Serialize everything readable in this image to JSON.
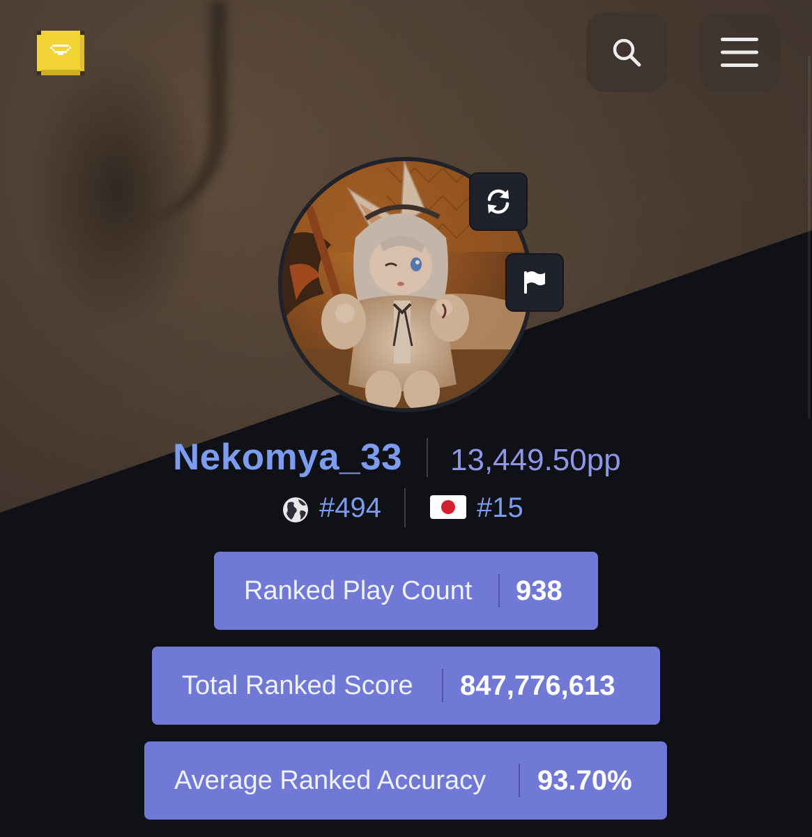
{
  "header": {
    "logo_icon": "pixel-gem-logo",
    "search_icon": "search-icon",
    "menu_icon": "hamburger-menu-icon"
  },
  "profile": {
    "avatar": "user-avatar-image",
    "username": "Nekomya_33",
    "pp": "13,449.50pp",
    "global_rank": "#494",
    "country_rank": "#15",
    "country_flag": "japan-flag",
    "actions": [
      "refresh-icon",
      "flag-icon"
    ]
  },
  "stats": [
    {
      "label": "Ranked Play Count",
      "value": "938"
    },
    {
      "label": "Total Ranked Score",
      "value": "847,776,613"
    },
    {
      "label": "Average Ranked Accuracy",
      "value": "93.70%"
    }
  ],
  "colors": {
    "accent": "#7079d6",
    "username": "#7c9cf0",
    "pp": "#8f96e8",
    "page_bg": "#0f1117",
    "logo": "#f2d437"
  }
}
